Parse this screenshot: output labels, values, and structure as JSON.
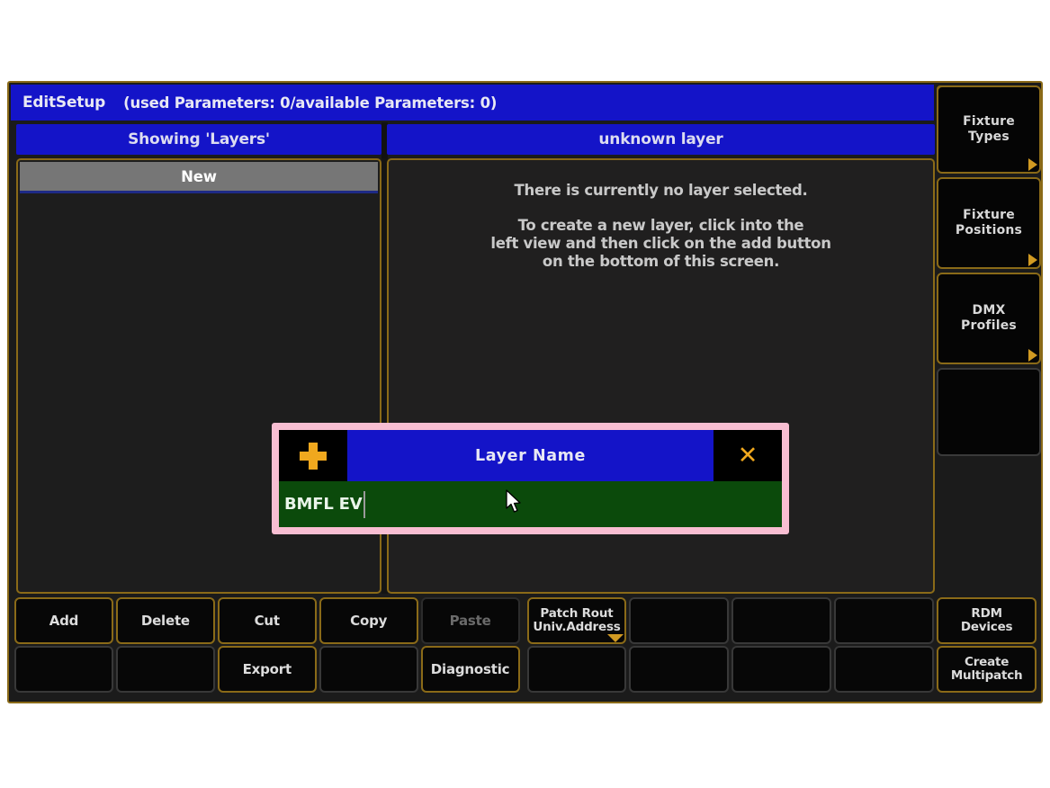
{
  "window": {
    "title": "EditSetup",
    "parameters_status": "(used Parameters: 0/available Parameters: 0)",
    "close_icon": "close-x-icon",
    "accent_gold": "#8a6a18",
    "accent_amber": "#f0a81e",
    "title_blue": "#1414c8"
  },
  "panels": {
    "left_header": "Showing 'Layers'",
    "right_header": "unknown layer",
    "left_list": [
      {
        "label": "New",
        "selected": true
      }
    ],
    "right_info": {
      "line1": "There is currently no layer selected.",
      "line2": "To create a new layer, click into the",
      "line3": "left view and then click on the add button",
      "line4": "on the bottom of this screen."
    }
  },
  "side_rail": [
    {
      "label_line1": "Fixture",
      "label_line2": "Types",
      "has_corner": true,
      "blank": false
    },
    {
      "label_line1": "Fixture",
      "label_line2": "Positions",
      "has_corner": true,
      "blank": false
    },
    {
      "label_line1": "DMX",
      "label_line2": "Profiles",
      "has_corner": true,
      "blank": false
    },
    {
      "label_line1": "",
      "label_line2": "",
      "has_corner": false,
      "blank": true
    }
  ],
  "toolbar": {
    "row1": [
      {
        "label_line1": "Add",
        "label_line2": "",
        "state": "enabled",
        "corner": false
      },
      {
        "label_line1": "Delete",
        "label_line2": "",
        "state": "enabled",
        "corner": false
      },
      {
        "label_line1": "Cut",
        "label_line2": "",
        "state": "enabled",
        "corner": false
      },
      {
        "label_line1": "Copy",
        "label_line2": "",
        "state": "enabled",
        "corner": false
      },
      {
        "label_line1": "Paste",
        "label_line2": "",
        "state": "disabled",
        "corner": false
      },
      {
        "label_line1": "Patch Rout",
        "label_line2": "Univ.Address",
        "state": "enabled",
        "corner": true
      },
      {
        "label_line1": "",
        "label_line2": "",
        "state": "blank",
        "corner": false
      },
      {
        "label_line1": "",
        "label_line2": "",
        "state": "blank",
        "corner": false
      },
      {
        "label_line1": "",
        "label_line2": "",
        "state": "blank",
        "corner": false
      },
      {
        "label_line1": "RDM",
        "label_line2": "Devices",
        "state": "enabled",
        "corner": false
      }
    ],
    "row2": [
      {
        "label_line1": "",
        "label_line2": "",
        "state": "blank",
        "corner": false
      },
      {
        "label_line1": "",
        "label_line2": "",
        "state": "blank",
        "corner": false
      },
      {
        "label_line1": "Export",
        "label_line2": "",
        "state": "enabled",
        "corner": false
      },
      {
        "label_line1": "",
        "label_line2": "",
        "state": "blank",
        "corner": false
      },
      {
        "label_line1": "Diagnostic",
        "label_line2": "",
        "state": "enabled",
        "corner": false
      },
      {
        "label_line1": "",
        "label_line2": "",
        "state": "blank",
        "corner": false
      },
      {
        "label_line1": "",
        "label_line2": "",
        "state": "blank",
        "corner": false
      },
      {
        "label_line1": "",
        "label_line2": "",
        "state": "blank",
        "corner": false
      },
      {
        "label_line1": "",
        "label_line2": "",
        "state": "blank",
        "corner": false
      },
      {
        "label_line1": "Create",
        "label_line2": "Multipatch",
        "state": "enabled",
        "corner": false
      }
    ]
  },
  "dialog": {
    "title": "Layer Name",
    "add_icon": "plus-icon",
    "close_icon": "close-x-icon",
    "input_value": "BMFL EV",
    "border_color": "#f8bed2",
    "input_bg": "#0b4a0b"
  }
}
